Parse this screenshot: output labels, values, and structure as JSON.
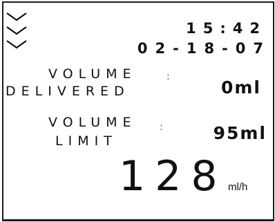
{
  "display": {
    "time": "15:42",
    "date": "02-18-07"
  },
  "volume_delivered": {
    "label_line1": "VOLUME",
    "label_line2": "DELIVERED",
    "separator": ":",
    "value": "0ml"
  },
  "volume_limit": {
    "label_line1": "VOLUME",
    "label_line2": "LIMIT",
    "separator": ":",
    "value": "95ml"
  },
  "infusion_rate": {
    "value": "128",
    "unit": "ml/h"
  },
  "icons": {
    "scroll_indicator": "triple-chevron-down-icon"
  },
  "colors": {
    "background": "#ffffff",
    "foreground": "#111111"
  }
}
